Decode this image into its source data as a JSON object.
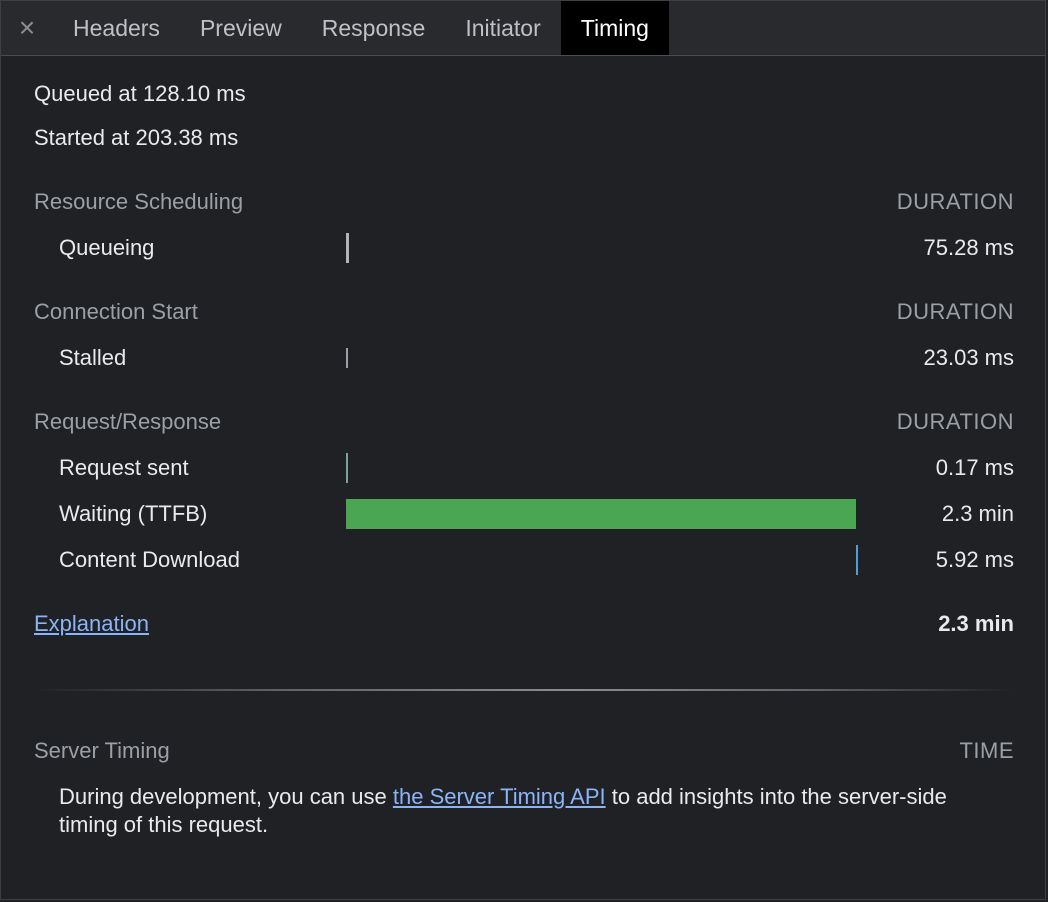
{
  "tabs": {
    "close_glyph": "×",
    "items": [
      {
        "label": "Headers"
      },
      {
        "label": "Preview"
      },
      {
        "label": "Response"
      },
      {
        "label": "Initiator"
      },
      {
        "label": "Timing",
        "active": true
      }
    ]
  },
  "timing": {
    "queued_at": "Queued at 128.10 ms",
    "started_at": "Started at 203.38 ms",
    "sections": [
      {
        "title": "Resource Scheduling",
        "column": "DURATION",
        "rows": [
          {
            "label": "Queueing",
            "value": "75.28 ms",
            "bar_color": "#b0b3b8"
          }
        ]
      },
      {
        "title": "Connection Start",
        "column": "DURATION",
        "rows": [
          {
            "label": "Stalled",
            "value": "23.03 ms",
            "bar_color": "#b0b3b8"
          }
        ]
      },
      {
        "title": "Request/Response",
        "column": "DURATION",
        "rows": [
          {
            "label": "Request sent",
            "value": "0.17 ms",
            "bar_color": "#7aa397"
          },
          {
            "label": "Waiting (TTFB)",
            "value": "2.3 min",
            "bar_color": "#4aa653"
          },
          {
            "label": "Content Download",
            "value": "5.92 ms",
            "bar_color": "#4b9fdc"
          }
        ]
      }
    ],
    "explanation_link": "Explanation",
    "total": "2.3 min"
  },
  "server_timing": {
    "title": "Server Timing",
    "column": "TIME",
    "desc_before": "During development, you can use ",
    "link_text": "the Server Timing API",
    "desc_after": " to add insights into the server-side timing of this request."
  },
  "colors": {
    "background": "#202124",
    "active_tab_bg": "#000000",
    "link": "#8ab4f8",
    "ttfb_bar": "#4aa653"
  }
}
